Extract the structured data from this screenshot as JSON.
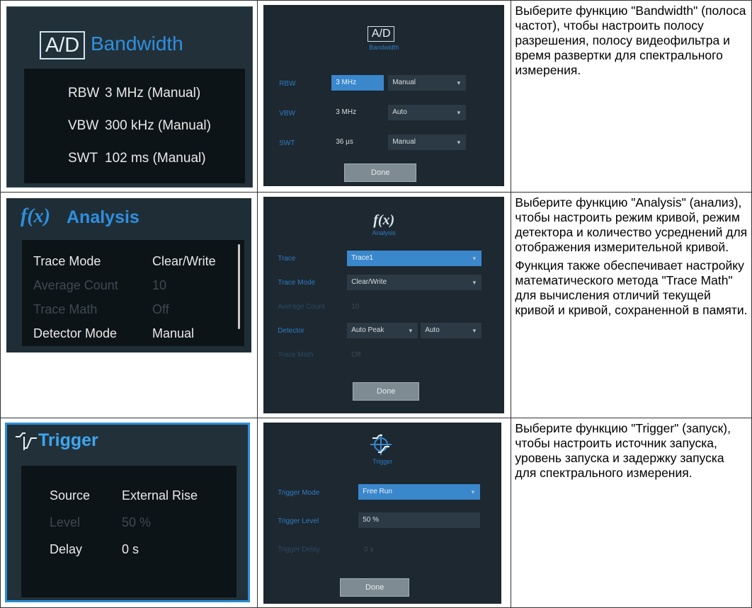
{
  "rows": [
    {
      "panel": {
        "badge": "A/D",
        "title": "Bandwidth",
        "items": [
          {
            "label": "RBW",
            "value": "3 MHz (Manual)"
          },
          {
            "label": "VBW",
            "value": "300 kHz (Manual)"
          },
          {
            "label": "SWT",
            "value": "102 ms (Manual)"
          }
        ]
      },
      "dialog": {
        "badge": "A/D",
        "subtitle": "Bandwidth",
        "fields": [
          {
            "label": "RBW",
            "value": "3 MHz",
            "mode": "Manual"
          },
          {
            "label": "VBW",
            "value": "3 MHz",
            "mode": "Auto"
          },
          {
            "label": "SWT",
            "value": "36 µs",
            "mode": "Manual"
          }
        ],
        "done": "Done"
      },
      "description": [
        "Выберите функцию \"Bandwidth\" (полоса частот), чтобы настроить полосу разрешения, полосу видеофильтра и время развертки для спектрального измерения."
      ]
    },
    {
      "panel": {
        "fx": "f(x)",
        "title": "Analysis",
        "items": [
          {
            "label": "Trace Mode",
            "value": "Clear/Write"
          },
          {
            "label": "Average Count",
            "value": "10"
          },
          {
            "label": "Trace Math",
            "value": "Off"
          },
          {
            "label": "Detector Mode",
            "value": "Manual"
          }
        ]
      },
      "dialog": {
        "fx": "f(x)",
        "subtitle": "Analysis",
        "fields": [
          {
            "label": "Trace",
            "value": "Trace1"
          },
          {
            "label": "Trace Mode",
            "value": "Clear/Write"
          },
          {
            "label": "Average Count",
            "value": "10"
          },
          {
            "label": "Detector",
            "value": "Auto Peak",
            "mode": "Auto"
          },
          {
            "label": "Trace Math",
            "value": "Off"
          }
        ],
        "done": "Done"
      },
      "description": [
        "Выберите функцию \"Analysis\" (анализ), чтобы настроить режим кривой, режим детектора и количество усреднений для отображения измерительной кривой.",
        "Функция также обеспечивает настройку математического метода \"Trace Math\" для вычисления отличий текущей кривой и кривой, сохраненной в памяти."
      ]
    },
    {
      "panel": {
        "title": "Trigger",
        "items": [
          {
            "label": "Source",
            "value": "External Rise"
          },
          {
            "label": "Level",
            "value": "50 %"
          },
          {
            "label": "Delay",
            "value": "0 s"
          }
        ]
      },
      "dialog": {
        "subtitle": "Trigger",
        "fields": [
          {
            "label": "Trigger Mode",
            "value": "Free Run"
          },
          {
            "label": "Trigger Level",
            "value": "50 %"
          },
          {
            "label": "Trigger Delay",
            "value": "0 s"
          }
        ],
        "done": "Done"
      },
      "description": [
        "Выберите функцию \"Trigger\" (запуск), чтобы настроить источник запуска, уровень запуска и задержку запуска для спектрального измерения."
      ]
    }
  ],
  "colors": {
    "panel_bg": "#223139",
    "accent_blue": "#2f8fe0",
    "dialog_bg": "#1d2830",
    "field_active": "#3a87cc"
  }
}
